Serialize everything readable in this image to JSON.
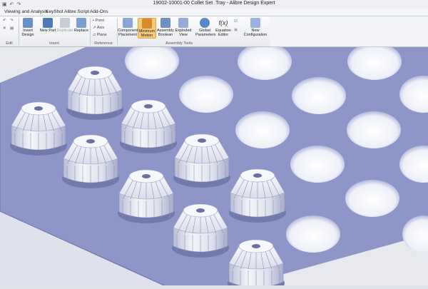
{
  "window": {
    "title": "19002-10001-00 Collet Set .Tray - Alibre Design Expert"
  },
  "menu": [
    "Viewing and Analysis",
    "KeyShot",
    "Alibre Script",
    "Add-Ons"
  ],
  "ribbon": {
    "groups": [
      "Edit",
      "Insert",
      "Reference",
      "Assembly Tools"
    ],
    "buttons": {
      "insert_design": "Insert Design",
      "new_part": "New Part",
      "duplicate": "Duplicate",
      "replace": "Replace",
      "point": "Point",
      "axis": "Axis",
      "plane": "Plane",
      "component_placement": "Component Placement",
      "minimum_motion": "Minimum Motion",
      "assembly_boolean": "Assembly Boolean",
      "exploded_view": "Exploded View",
      "global_parameters": "Global Parameters",
      "equation_editor": "Equation Editor",
      "new_configuration": "New Configuration"
    }
  },
  "colors": {
    "tray": "#8e96c8",
    "collet": "#e6e8f2",
    "ribbon_active": "#f7c97a"
  }
}
